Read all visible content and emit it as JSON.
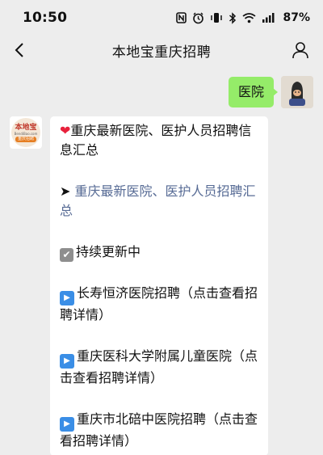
{
  "status_bar": {
    "time": "10:50",
    "battery": "87%"
  },
  "nav": {
    "title": "本地宝重庆招聘"
  },
  "outgoing": {
    "text": "医院"
  },
  "bot_avatar": {
    "logo_text": "本地宝",
    "logo_url_text": "BendiBao.com",
    "logo_sub": "重庆招聘"
  },
  "incoming": {
    "heading": "重庆最新医院、医护人员招聘信息汇总",
    "link": "重庆最新医院、医护人员招聘汇总",
    "status": "持续更新中",
    "items": [
      "长寿恒济医院招聘（点击查看招聘详情）",
      "重庆医科大学附属儿童医院（点击查看招聘详情）",
      "重庆市北碚中医院招聘（点击查看招聘详情）"
    ]
  },
  "icons": {
    "heart": "❤",
    "arrow": "➤",
    "check": "✔",
    "play": "▶"
  }
}
